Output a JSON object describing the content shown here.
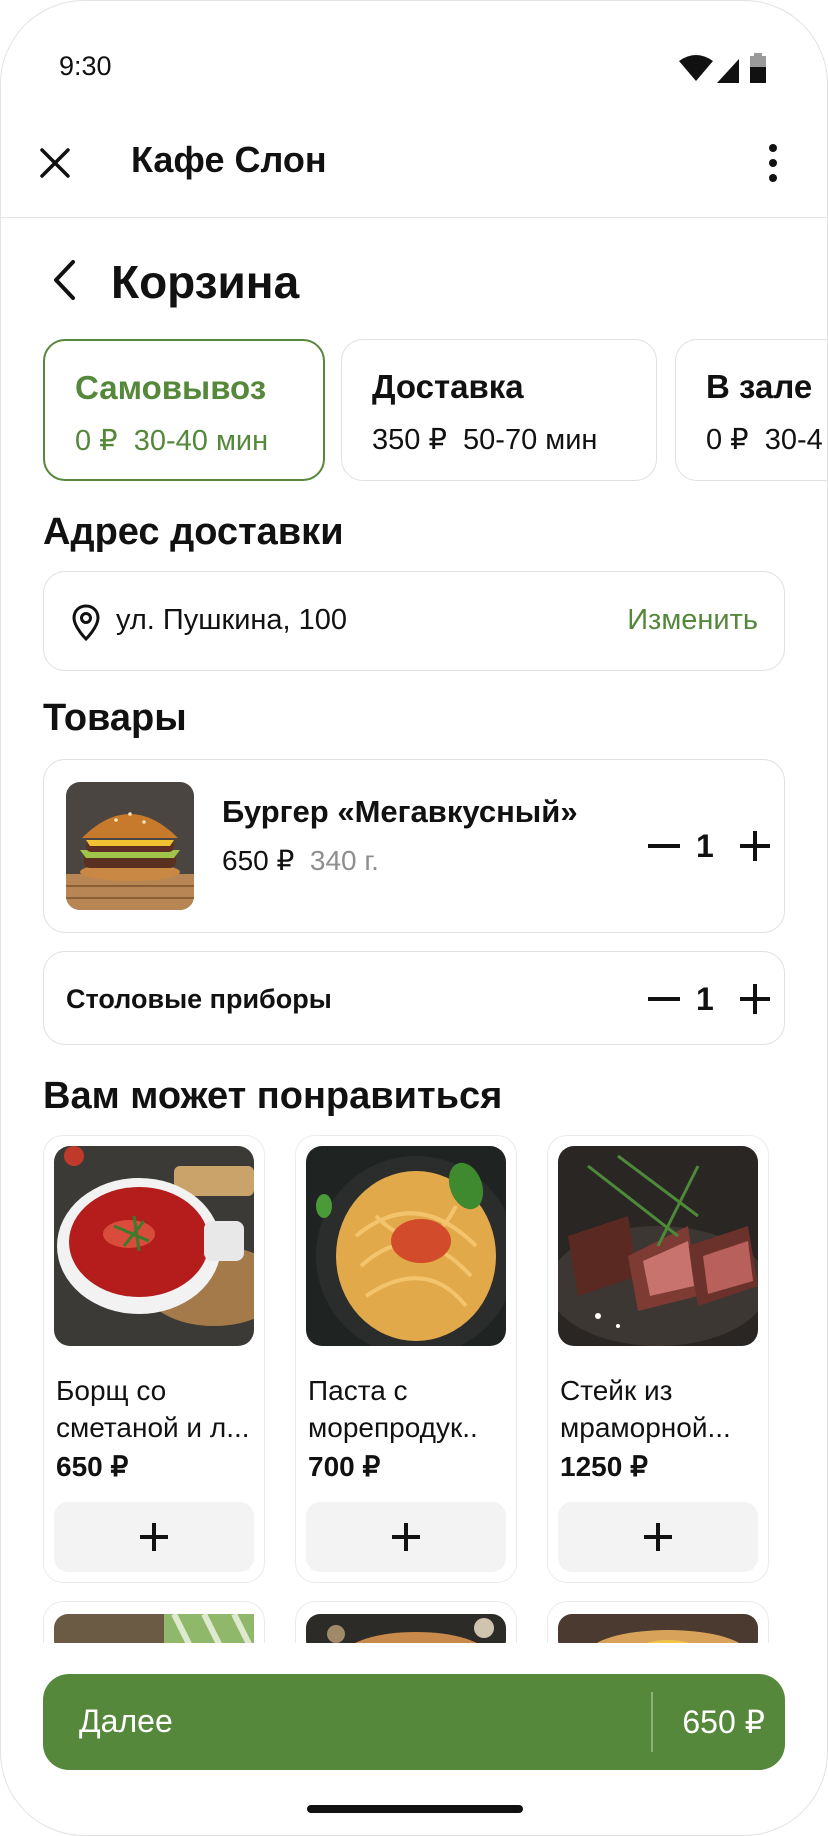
{
  "status_bar": {
    "time": "9:30"
  },
  "app_bar": {
    "title": "Кафе Слон",
    "close_icon": "close-icon",
    "menu_icon": "more-vert-icon"
  },
  "page": {
    "title": "Корзина"
  },
  "delivery_options": [
    {
      "name": "Самовывоз",
      "price": "0 ₽",
      "time": "30-40 мин",
      "selected": true
    },
    {
      "name": "Доставка",
      "price": "350 ₽",
      "time": "50-70 мин",
      "selected": false
    },
    {
      "name": "В зале",
      "price": "0 ₽",
      "time": "30-4",
      "selected": false
    }
  ],
  "address": {
    "title": "Адрес доставки",
    "value": "ул. Пушкина, 100",
    "change_label": "Изменить"
  },
  "goods": {
    "title": "Товары",
    "items": [
      {
        "name": "Бургер «Мегавкусный»",
        "price": "650 ₽",
        "weight": "340 г.",
        "qty": "1"
      }
    ],
    "cutlery": {
      "label": "Столовые приборы",
      "qty": "1"
    }
  },
  "recommendations": {
    "title": "Вам может понравиться",
    "items": [
      {
        "name_line1": "Борщ со",
        "name_line2": "сметаной и л...",
        "price": "650 ₽"
      },
      {
        "name_line1": "Паста с",
        "name_line2": "морепродук..",
        "price": "700 ₽"
      },
      {
        "name_line1": "Стейк из",
        "name_line2": "мраморной...",
        "price": "1250 ₽"
      }
    ]
  },
  "cta": {
    "label": "Далее",
    "total": "650 ₽"
  },
  "colors": {
    "accent": "#55883a",
    "border": "#e0e0e0",
    "button_bg": "#f3f3f3"
  }
}
